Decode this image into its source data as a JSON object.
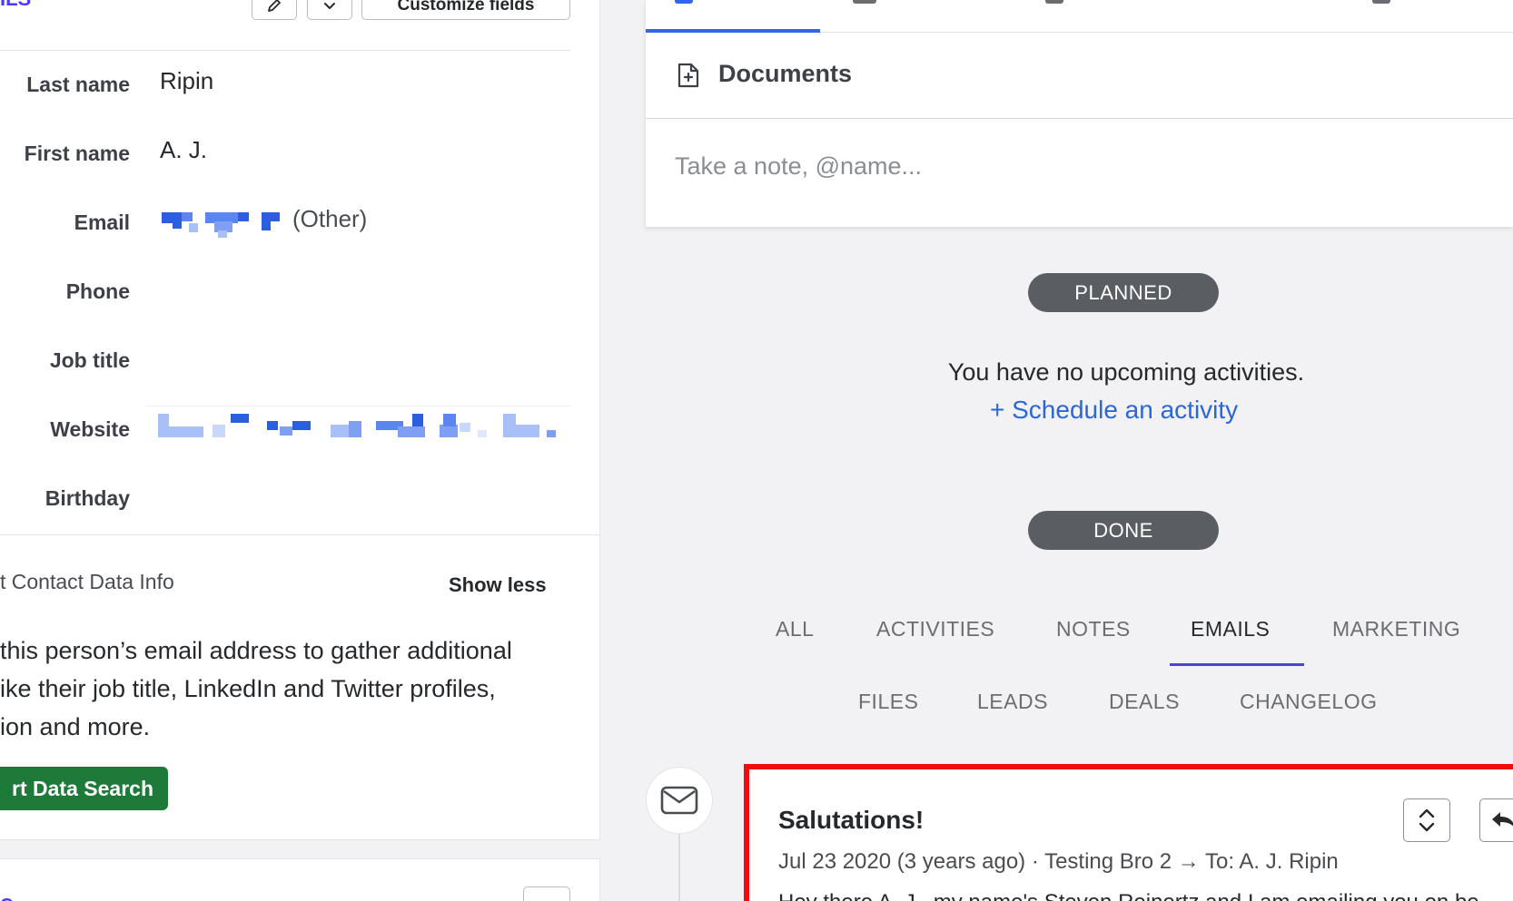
{
  "details": {
    "section_title": "ILS",
    "customize_label": "Customize fields",
    "fields": [
      {
        "label": "Last name",
        "value": "Ripin"
      },
      {
        "label": "First name",
        "value": "A. J."
      },
      {
        "label": "Email",
        "value": "(Other)"
      },
      {
        "label": "Phone",
        "value": ""
      },
      {
        "label": "Job title",
        "value": ""
      },
      {
        "label": "Website",
        "value": ""
      },
      {
        "label": "Birthday",
        "value": ""
      }
    ]
  },
  "contact_data": {
    "title": "t Contact Data Info",
    "show_less": "Show less",
    "description_lines": [
      "this person’s email address to gather additional",
      "ike their job title, LinkedIn and Twitter profiles,",
      "ion and more."
    ],
    "button_label": "rt Data Search"
  },
  "next_card": {
    "title_fragment": "C"
  },
  "composer": {
    "documents_label": "Documents",
    "note_placeholder": "Take a note, @name..."
  },
  "timeline": {
    "planned_label": "PLANNED",
    "no_activities_text": "You have no upcoming activities.",
    "schedule_link": "+ Schedule an activity",
    "done_label": "DONE",
    "filter_tabs": [
      "ALL",
      "ACTIVITIES",
      "NOTES",
      "EMAILS",
      "MARKETING",
      "FILES",
      "LEADS",
      "DEALS",
      "CHANGELOG"
    ],
    "active_filter": "EMAILS"
  },
  "email_item": {
    "subject": "Salutations!",
    "meta": "Jul 23 2020 (3 years ago) · Testing Bro 2 → To: A. J. Ripin",
    "preview": "Hey there A. J., my name's Steven Reinertz and I am emailing you on be"
  },
  "colors": {
    "accent": "#4a3aff",
    "link": "#2b67d9",
    "tab_active": "#3166e8",
    "pill": "#5a5e63",
    "smart_button": "#1e7a38",
    "highlight_border": "#f20d0d"
  },
  "icons": {
    "edit": "pencil-icon",
    "dropdown": "chevron-down-icon",
    "document": "document-icon",
    "mail": "mail-icon",
    "expand": "expand-collapse-icon",
    "reply": "reply-icon"
  }
}
